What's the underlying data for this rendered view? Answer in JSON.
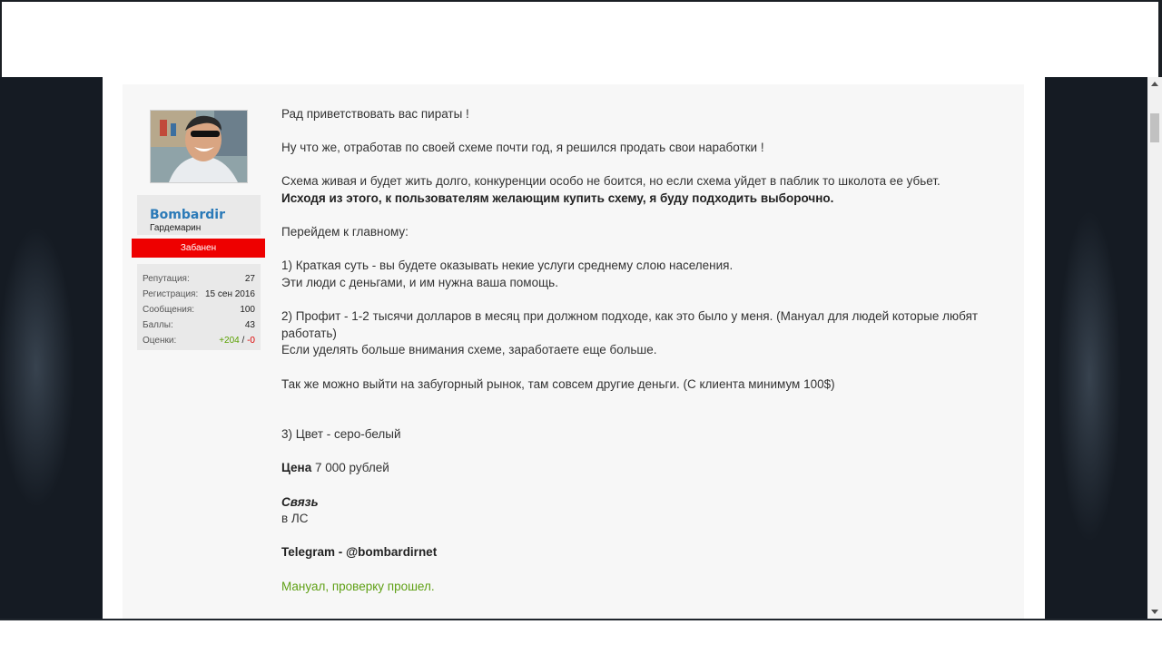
{
  "user": {
    "name": "Bombardir",
    "title": "Гардемарин",
    "status": "Забанен",
    "stats": [
      {
        "label": "Репутация:",
        "value": "27"
      },
      {
        "label": "Регистрация:",
        "value": "15 сен 2016"
      },
      {
        "label": "Сообщения:",
        "value": "100"
      },
      {
        "label": "Баллы:",
        "value": "43"
      }
    ],
    "ratings_label": "Оценки:",
    "ratings_pos": "+204",
    "ratings_sep": " / ",
    "ratings_neg": "-0"
  },
  "message": {
    "l1": "Рад приветствовать вас пираты !",
    "l2": "Ну что же, отработав по своей схеме почти год, я решился продать свои наработки !",
    "l3": "Схема живая и будет жить долго, конкуренции особо не боится, но если схема уйдет в паблик то школота ее убьет.",
    "l4": "Исходя из этого, к пользователям желающим купить схему, я буду подходить выборочно.",
    "l5": "Перейдем к главному:",
    "l6": "1) Краткая суть - вы будете оказывать некие услуги среднему слою населения.",
    "l7": "Эти люди с деньгами, и им нужна ваша помощь.",
    "l8": "2) Профит - 1-2 тысячи долларов в месяц при должном подходе, как это было у меня. (Мануал для людей которые любят работать)",
    "l9": "Если уделять больше внимания схеме, заработаете еще больше.",
    "l10": "Так же можно выйти на забугорный рынок, там совсем другие деньги. (С клиента минимум 100$)",
    "l11": "3) Цвет - серо-белый",
    "price_label": "Цена",
    "price_value": " 7 000 рублей",
    "contact_label": "Связь",
    "contact_value": "в ЛС",
    "telegram": "Telegram - @bombardirnet",
    "manual_note": "Мануал, проверку прошел."
  }
}
